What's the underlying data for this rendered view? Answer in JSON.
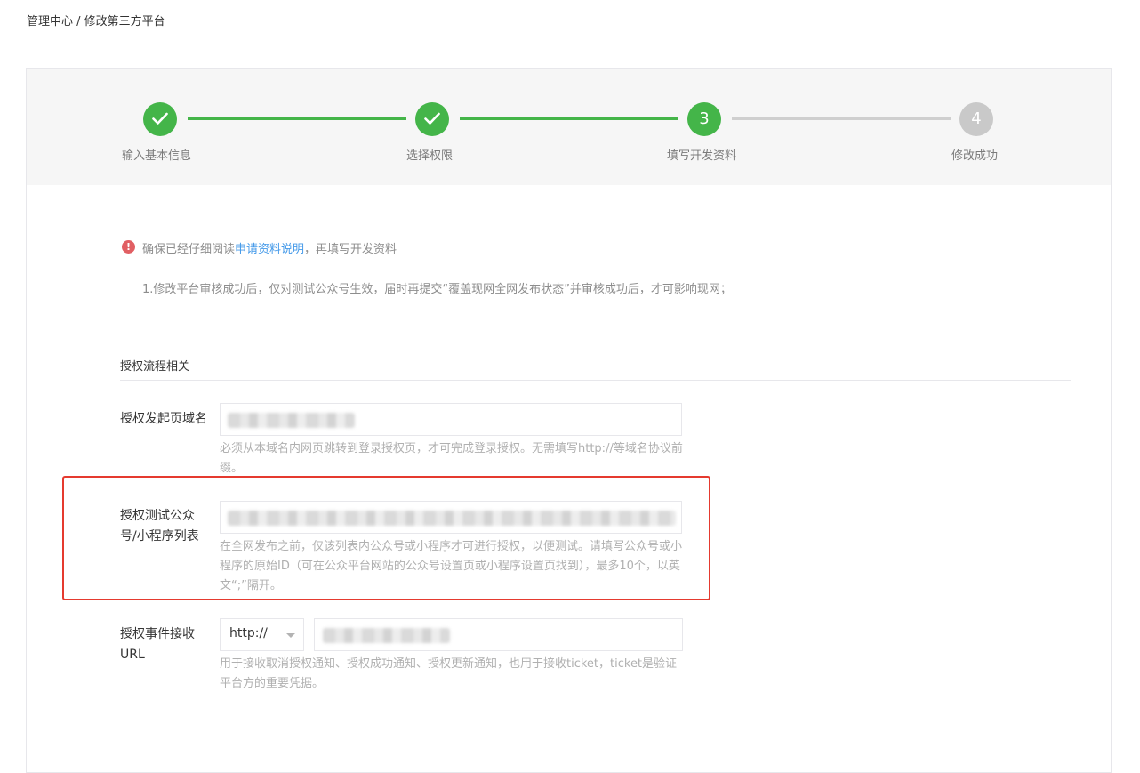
{
  "breadcrumb": "管理中心 / 修改第三方平台",
  "steps": [
    {
      "number": "",
      "label": "输入基本信息",
      "status": "done"
    },
    {
      "number": "",
      "label": "选择权限",
      "status": "done"
    },
    {
      "number": "3",
      "label": "填写开发资料",
      "status": "active"
    },
    {
      "number": "4",
      "label": "修改成功",
      "status": "todo"
    }
  ],
  "notice": {
    "prefix": "确保已经仔细阅读",
    "link": "申请资料说明",
    "suffix": "，再填写开发资料",
    "note": "1.修改平台审核成功后，仅对测试公众号生效，届时再提交“覆盖现网全网发布状态”并审核成功后，才可影响现网；"
  },
  "section": {
    "title": "授权流程相关"
  },
  "fields": {
    "domain": {
      "label": "授权发起页域名",
      "hint": "必须从本域名内网页跳转到登录授权页，才可完成登录授权。无需填写http://等域名协议前缀。"
    },
    "test_accounts": {
      "label_line1": "授权测试公众",
      "label_line2": "号/小程序列表",
      "hint": "在全网发布之前，仅该列表内公众号或小程序才可进行授权，以便测试。请填写公众号或小程序的原始ID（可在公众平台网站的公众号设置页或小程序设置页找到），最多10个，以英文“;”隔开。"
    },
    "event_url": {
      "label_line1": "授权事件接收",
      "label_line2": "URL",
      "protocol": "http://",
      "hint": "用于接收取消授权通知、授权成功通知、授权更新通知，也用于接收ticket，ticket是验证平台方的重要凭据。"
    }
  },
  "colors": {
    "accent": "#44b549",
    "link": "#459ae9",
    "warning": "#e15f63",
    "highlight": "#e53a2f"
  }
}
